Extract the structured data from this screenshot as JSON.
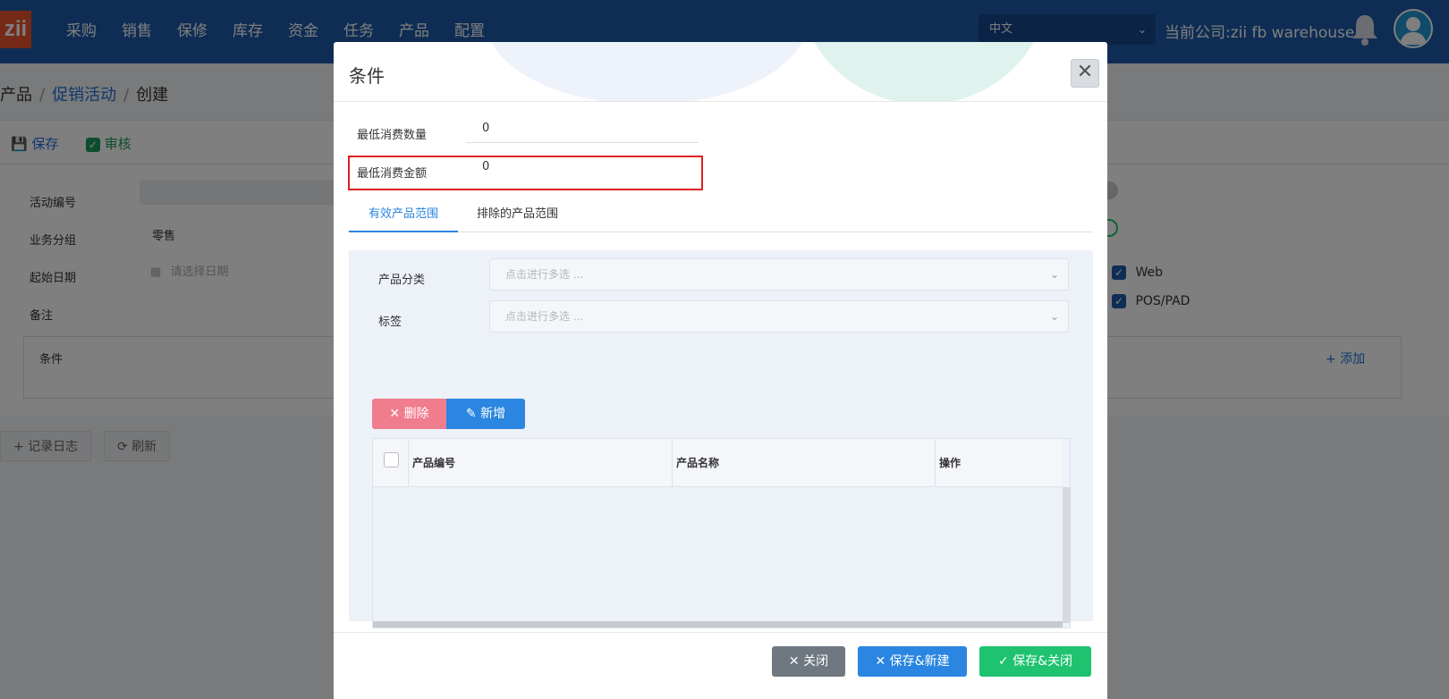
{
  "nav": {
    "logo": "zii",
    "menu": [
      "采购",
      "销售",
      "保修",
      "库存",
      "资金",
      "任务",
      "产品",
      "配置"
    ],
    "language": "中文",
    "company": "当前公司:zii fb warehouse"
  },
  "page": {
    "breadcrumb": {
      "root": "产品",
      "parent": "促销活动",
      "current": "创建"
    },
    "toolbar": {
      "save": "保存",
      "audit": "审核"
    },
    "fields": {
      "activity_no_label": "活动编号",
      "business_group_label": "业务分组",
      "business_group_value": "零售",
      "start_date_label": "起始日期",
      "start_date_placeholder": "请选择日期",
      "remark_label": "备注",
      "condition_label": "条件",
      "add_label": "添加"
    },
    "channels": [
      "Web",
      "POS/PAD"
    ],
    "log_button": "记录日志",
    "refresh_button": "刷新"
  },
  "modal": {
    "title": "条件",
    "min_qty_label": "最低消费数量",
    "min_qty_value": "0",
    "min_amount_label": "最低消费金额",
    "min_amount_value": "0",
    "tabs": [
      {
        "label": "有效产品范围",
        "active": true
      },
      {
        "label": "排除的产品范围",
        "active": false
      }
    ],
    "category_label": "产品分类",
    "category_placeholder": "点击进行多选 ...",
    "tag_label": "标签",
    "tag_placeholder": "点击进行多选 ...",
    "delete_button": "删除",
    "new_button": "新增",
    "table_headers": [
      "产品编号",
      "产品名称",
      "操作"
    ],
    "footer": {
      "close": "关闭",
      "save_new": "保存&新建",
      "save_close": "保存&关闭"
    }
  },
  "colors": {
    "nav_bg": "#1e5aa8",
    "accent_blue": "#2a86e0",
    "danger_pink": "#ef7d8e",
    "success_green": "#1fc36f",
    "highlight_red": "#e02020"
  }
}
